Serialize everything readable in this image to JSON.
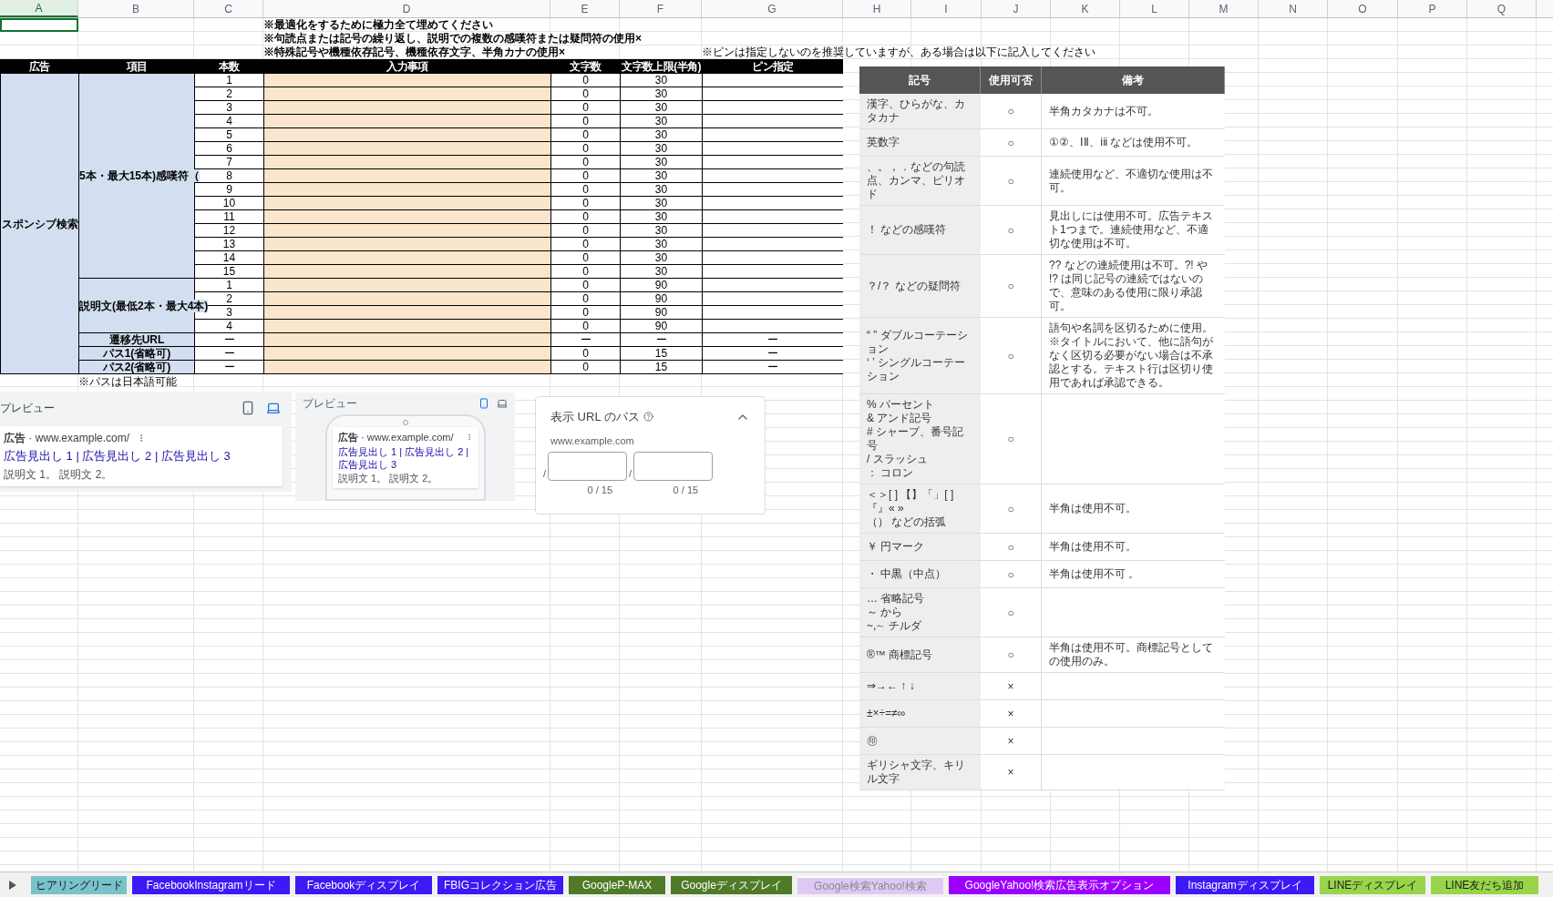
{
  "columns": [
    {
      "label": "A",
      "selected": true
    },
    {
      "label": "B",
      "selected": false
    },
    {
      "label": "C",
      "selected": false
    },
    {
      "label": "D",
      "selected": false
    },
    {
      "label": "E",
      "selected": false
    },
    {
      "label": "F",
      "selected": false
    },
    {
      "label": "G",
      "selected": false
    },
    {
      "label": "H",
      "selected": false
    },
    {
      "label": "I",
      "selected": false
    },
    {
      "label": "J",
      "selected": false
    },
    {
      "label": "K",
      "selected": false
    },
    {
      "label": "L",
      "selected": false
    },
    {
      "label": "M",
      "selected": false
    },
    {
      "label": "N",
      "selected": false
    },
    {
      "label": "O",
      "selected": false
    },
    {
      "label": "P",
      "selected": false
    },
    {
      "label": "Q",
      "selected": false
    }
  ],
  "notes": [
    "※最適化をするために極力全て埋めてください",
    "※句読点または記号の繰り返し、説明での複数の感嘆符または疑問符の使用×",
    "※特殊記号や機種依存記号、機種依存文字、半角カナの使用×"
  ],
  "pin_note": "※ピンは指定しないのを推奨していますが、ある場合は以下に記入してください",
  "table": {
    "headers": [
      "広告",
      "項目",
      "本数",
      "入力事項",
      "文字数",
      "文字数上限(半角)",
      "ピン指定"
    ],
    "ad_type": "スポンシブ検索",
    "groups": [
      {
        "label": "5本・最大15本)感嘆符（",
        "rows": [
          {
            "no": "1",
            "count": "0",
            "limit": "30"
          },
          {
            "no": "2",
            "count": "0",
            "limit": "30"
          },
          {
            "no": "3",
            "count": "0",
            "limit": "30"
          },
          {
            "no": "4",
            "count": "0",
            "limit": "30"
          },
          {
            "no": "5",
            "count": "0",
            "limit": "30"
          },
          {
            "no": "6",
            "count": "0",
            "limit": "30"
          },
          {
            "no": "7",
            "count": "0",
            "limit": "30"
          },
          {
            "no": "8",
            "count": "0",
            "limit": "30"
          },
          {
            "no": "9",
            "count": "0",
            "limit": "30"
          },
          {
            "no": "10",
            "count": "0",
            "limit": "30"
          },
          {
            "no": "11",
            "count": "0",
            "limit": "30"
          },
          {
            "no": "12",
            "count": "0",
            "limit": "30"
          },
          {
            "no": "13",
            "count": "0",
            "limit": "30"
          },
          {
            "no": "14",
            "count": "0",
            "limit": "30"
          },
          {
            "no": "15",
            "count": "0",
            "limit": "30"
          }
        ]
      },
      {
        "label": "説明文(最低2本・最大4本)",
        "rows": [
          {
            "no": "1",
            "count": "0",
            "limit": "90"
          },
          {
            "no": "2",
            "count": "0",
            "limit": "90"
          },
          {
            "no": "3",
            "count": "0",
            "limit": "90"
          },
          {
            "no": "4",
            "count": "0",
            "limit": "90"
          }
        ]
      },
      {
        "label": "遷移先URL",
        "rows": [
          {
            "no": "ー",
            "count": "ー",
            "limit": "ー",
            "pin": "ー"
          }
        ]
      },
      {
        "label": "パス1(省略可)",
        "rows": [
          {
            "no": "ー",
            "count": "0",
            "limit": "15",
            "pin": "ー"
          }
        ]
      },
      {
        "label": "パス2(省略可)",
        "rows": [
          {
            "no": "ー",
            "count": "0",
            "limit": "15",
            "pin": "ー"
          }
        ]
      }
    ],
    "footnote": "※パスは日本語可能"
  },
  "symbols": {
    "headers": [
      "記号",
      "使用可否",
      "備考"
    ],
    "rows": [
      {
        "symbol": [
          "漢字、ひらがな、カタカナ"
        ],
        "usable": "○",
        "note": "半角カタカナは不可。"
      },
      {
        "symbol": [
          "英数字"
        ],
        "usable": "○",
        "note": "①②、ⅠⅡ、ⅰⅱ などは使用不可。"
      },
      {
        "symbol": [
          "、。，．などの句読点、カンマ、ピリオド"
        ],
        "usable": "○",
        "note": "連続使用など、不適切な使用は不可。"
      },
      {
        "symbol": [
          "！ などの感嘆符"
        ],
        "usable": "○",
        "note": "見出しには使用不可。広告テキスト1つまで。連続使用など、不適切な使用は不可。"
      },
      {
        "symbol": [
          "？/？ などの疑問符"
        ],
        "usable": "○",
        "note": "?? などの連続使用は不可。?! や !? は同じ記号の連続ではないので、意味のある使用に限り承認可。"
      },
      {
        "symbol": [
          "“ ” ダブルコーテーション",
          "‘ ’ シングルコーテーション"
        ],
        "usable": "○",
        "note": "語句や名詞を区切るために使用。※タイトルにおいて、他に語句がなく区切る必要がない場合は不承認とする。テキスト行は区切り使用であれば承認できる。"
      },
      {
        "symbol": [
          "% パーセント",
          "& アンド記号",
          "# シャープ、番号記号",
          "/ スラッシュ",
          "： コロン"
        ],
        "usable": "○"
      },
      {
        "symbol": [
          "＜＞[ ] 【】「」[ ]『』« »",
          "（） などの括弧"
        ],
        "usable": "○",
        "note": "半角は使用不可。"
      },
      {
        "symbol": [
          "￥ 円マーク"
        ],
        "usable": "○",
        "note": "半角は使用不可。"
      },
      {
        "symbol": [
          "・ 中黒（中点）"
        ],
        "usable": "○",
        "note": "半角は使用不可 。"
      },
      {
        "symbol": [
          "… 省略記号",
          "～ から",
          "~,∼ チルダ"
        ],
        "usable": "○"
      },
      {
        "symbol": [
          "®™ 商標記号"
        ],
        "usable": "○",
        "note": "半角は使用不可。商標記号としての使用のみ。"
      },
      {
        "symbol": [
          "⇒→← ↑ ↓"
        ],
        "usable": "×"
      },
      {
        "symbol": [
          "±×÷=≠∞"
        ],
        "usable": "×"
      },
      {
        "symbol": [
          "㊞"
        ],
        "usable": "×"
      },
      {
        "symbol": [
          "ギリシャ文字、キリル文字"
        ],
        "usable": "×"
      }
    ]
  },
  "previews": [
    {
      "kind": "desktop",
      "title": "プレビュー",
      "devices": [
        {
          "kind": "mobile",
          "selected": false
        },
        {
          "kind": "desktop",
          "selected": true
        }
      ],
      "ad_label": "広告",
      "url_separator": "·",
      "url": "www.example.com/",
      "headline": "広告見出し 1 | 広告見出し 2 | 広告見出し 3",
      "description": "説明文 1。 説明文 2。"
    },
    {
      "kind": "mobile",
      "title": "プレビュー",
      "devices": [
        {
          "kind": "mobile",
          "selected": true
        },
        {
          "kind": "desktop",
          "selected": false
        }
      ],
      "ad_label": "広告",
      "url_separator": "·",
      "url": "www.example.com/",
      "headline": "広告見出し 1 | 広告見出し 2 | 広告見出し 3",
      "description": "説明文 1。 説明文 2。"
    }
  ],
  "path_panel": {
    "title": "表示 URL のパス",
    "domain": "www.example.com",
    "fields": [
      {
        "separator": "/",
        "counter": "0 / 15"
      },
      {
        "separator": "/",
        "counter": "0 / 15"
      }
    ]
  },
  "sheet_tabs": [
    {
      "label": "ヒアリングリード",
      "color": "#79c2c9",
      "selected": false
    },
    {
      "label": "FacebookInstagramリード",
      "color": "#3c19f5",
      "selected": false
    },
    {
      "label": "Facebookディスプレイ",
      "color": "#3c19f5",
      "selected": false
    },
    {
      "label": "FBIGコレクション広告",
      "color": "#3c19f5",
      "selected": false
    },
    {
      "label": "GoogleP-MAX",
      "color": "#4f7a28",
      "selected": false
    },
    {
      "label": "Googleディスプレイ",
      "color": "#4f7a28",
      "selected": false
    },
    {
      "label": "Google検索Yahoo!検索",
      "color": "#dec9f6",
      "selected": true
    },
    {
      "label": "GoogleYahoo!検索広告表示オプション",
      "color": "#9b00ff",
      "selected": false
    },
    {
      "label": "Instagramディスプレイ",
      "color": "#3c19f5",
      "selected": false
    },
    {
      "label": "LINEディスプレイ",
      "color": "#98d54a",
      "selected": false
    },
    {
      "label": "LINE友だち追加",
      "color": "#98d54a",
      "selected": false
    }
  ]
}
